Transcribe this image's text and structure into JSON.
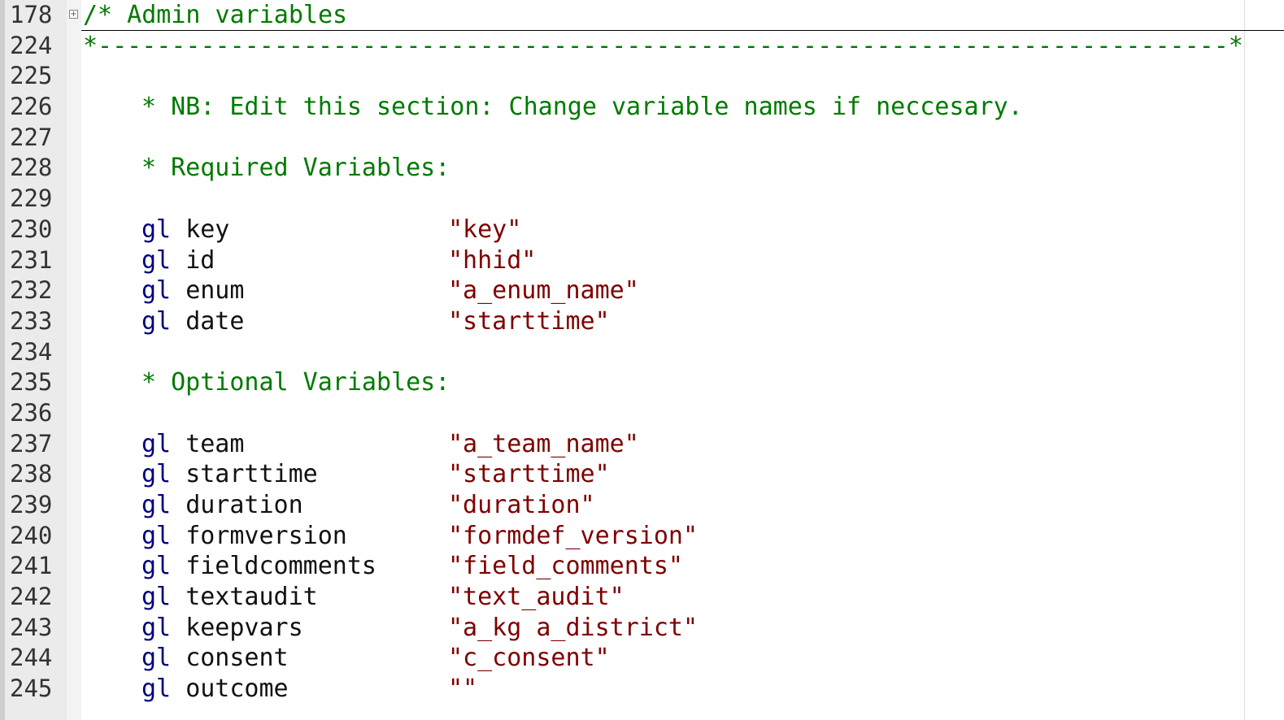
{
  "editor": {
    "colors": {
      "comment": "#007a00",
      "keyword": "#00007f",
      "string": "#7f0000",
      "gutter": "#ebebeb"
    },
    "fold_icon": "plus-box-icon",
    "lines": [
      {
        "num": "178",
        "kind": "fold-header",
        "text": "/* Admin variables"
      },
      {
        "num": "224",
        "kind": "comment",
        "text": "*-----------------------------------------------------------------------------*"
      },
      {
        "num": "225",
        "kind": "blank"
      },
      {
        "num": "226",
        "kind": "indent-comment",
        "text": "* NB: Edit this section: Change variable names if neccesary."
      },
      {
        "num": "227",
        "kind": "blank"
      },
      {
        "num": "228",
        "kind": "indent-comment",
        "text": "* Required Variables:"
      },
      {
        "num": "229",
        "kind": "blank"
      },
      {
        "num": "230",
        "kind": "gl",
        "kw": "gl",
        "name": "key",
        "value": "\"key\""
      },
      {
        "num": "231",
        "kind": "gl",
        "kw": "gl",
        "name": "id",
        "value": "\"hhid\""
      },
      {
        "num": "232",
        "kind": "gl",
        "kw": "gl",
        "name": "enum",
        "value": "\"a_enum_name\""
      },
      {
        "num": "233",
        "kind": "gl",
        "kw": "gl",
        "name": "date",
        "value": "\"starttime\""
      },
      {
        "num": "234",
        "kind": "blank"
      },
      {
        "num": "235",
        "kind": "indent-comment",
        "text": "* Optional Variables:"
      },
      {
        "num": "236",
        "kind": "blank"
      },
      {
        "num": "237",
        "kind": "gl",
        "kw": "gl",
        "name": "team",
        "value": "\"a_team_name\""
      },
      {
        "num": "238",
        "kind": "gl",
        "kw": "gl",
        "name": "starttime",
        "value": "\"starttime\""
      },
      {
        "num": "239",
        "kind": "gl",
        "kw": "gl",
        "name": "duration",
        "value": "\"duration\""
      },
      {
        "num": "240",
        "kind": "gl",
        "kw": "gl",
        "name": "formversion",
        "value": "\"formdef_version\""
      },
      {
        "num": "241",
        "kind": "gl",
        "kw": "gl",
        "name": "fieldcomments",
        "value": "\"field_comments\""
      },
      {
        "num": "242",
        "kind": "gl",
        "kw": "gl",
        "name": "textaudit",
        "value": "\"text_audit\""
      },
      {
        "num": "243",
        "kind": "gl",
        "kw": "gl",
        "name": "keepvars",
        "value": "\"a_kg a_district\""
      },
      {
        "num": "244",
        "kind": "gl",
        "kw": "gl",
        "name": "consent",
        "value": "\"c_consent\""
      },
      {
        "num": "245",
        "kind": "gl",
        "kw": "gl",
        "name": "outcome",
        "value": "\"\""
      }
    ]
  }
}
